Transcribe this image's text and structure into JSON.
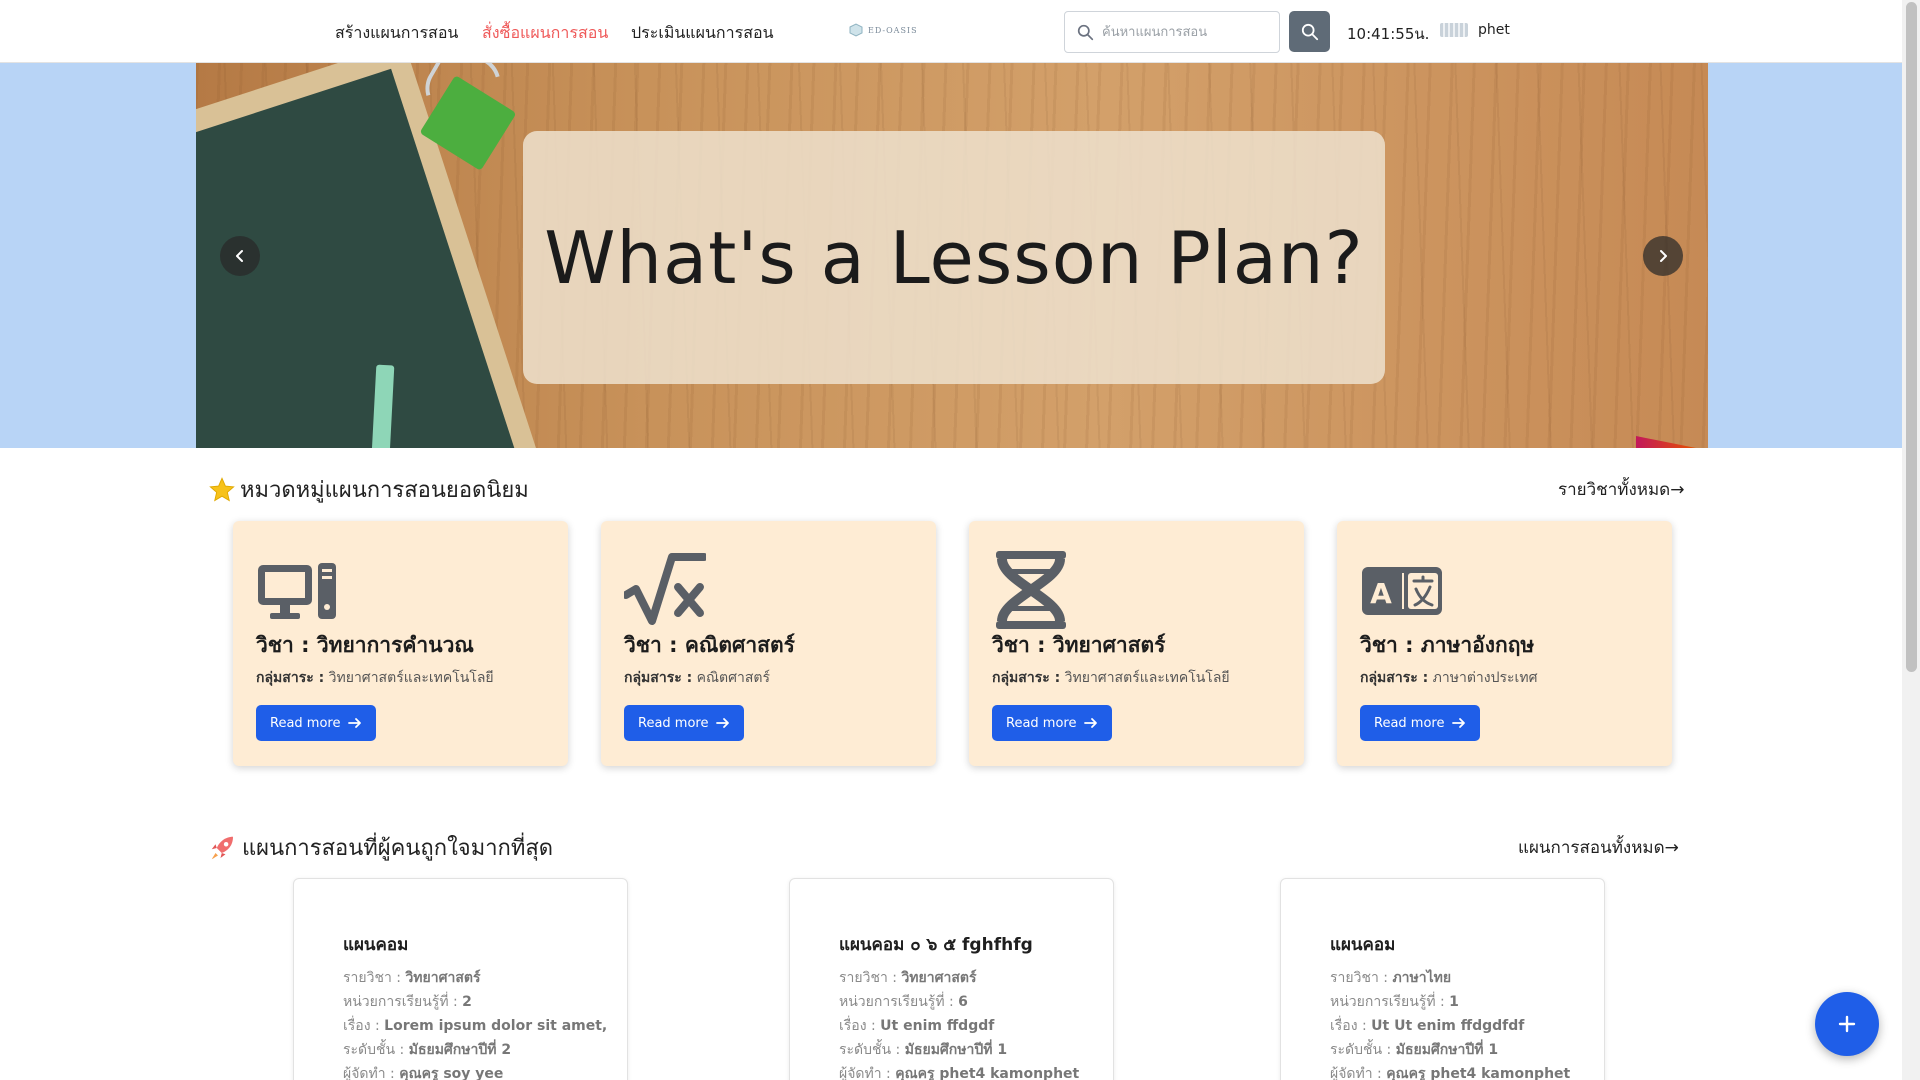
{
  "header": {
    "nav": [
      {
        "label": "สร้างแผนการสอน",
        "active": false
      },
      {
        "label": "สั่งซื้อแผนการสอน",
        "active": true
      },
      {
        "label": "ประเมินแผนการสอน",
        "active": false
      }
    ],
    "logo_text": "ED-OASIS",
    "search_placeholder": "ค้นหาแผนการสอน",
    "clock": "10:41:55น.",
    "username": "phet"
  },
  "banner": {
    "title": "What's a Lesson Plan?"
  },
  "popular_categories": {
    "title": "หมวดหมู่แผนการสอนยอดนิยม",
    "see_all": "รายวิชาทั้งหมด→",
    "group_label": "กลุ่มสาระ :",
    "read_more": "Read more",
    "cards": [
      {
        "subject": "วิชา : วิทยาการคำนวณ",
        "group": "วิทยาศาสตร์และเทคโนโลยี",
        "icon": "computer-icon"
      },
      {
        "subject": "วิชา : คณิตศาสตร์",
        "group": "คณิตศาสตร์",
        "icon": "square-root-icon"
      },
      {
        "subject": "วิชา : วิทยาศาสตร์",
        "group": "วิทยาศาสตร์และเทคโนโลยี",
        "icon": "dna-icon"
      },
      {
        "subject": "วิชา : ภาษาอังกฤษ",
        "group": "ภาษาต่างประเทศ",
        "icon": "language-icon"
      }
    ]
  },
  "popular_plans": {
    "title": "แผนการสอนที่ผู้คนถูกใจมากที่สุด",
    "see_all": "แผนการสอนทั้งหมด→",
    "labels": {
      "course": "รายวิชา :",
      "unit": "หน่วยการเรียนรู้ที่ :",
      "topic": "เรื่อง :",
      "level": "ระดับชั้น :",
      "author": "ผู้จัดทำ :"
    },
    "cards": [
      {
        "title": "แผนคอม",
        "course": "วิทยาศาสตร์",
        "unit": "2",
        "topic": "Lorem ipsum dolor sit amet,",
        "level": "มัธยมศึกษาปีที่ 2",
        "author": "คุณครู soy yee"
      },
      {
        "title": "แผนคอม ๐ ๖ ๕ fghfhfg",
        "course": "วิทยาศาสตร์",
        "unit": "6",
        "topic": "Ut enim ffdgdf",
        "level": "มัธยมศึกษาปีที่ 1",
        "author": "คุณครู phet4 kamonphet"
      },
      {
        "title": "แผนคอม",
        "course": "ภาษาไทย",
        "unit": "1",
        "topic": "Ut Ut enim ffdgdfdf",
        "level": "มัธยมศึกษาปีที่ 1",
        "author": "คุณครู phet4 kamonphet"
      }
    ]
  },
  "colors": {
    "primary": "#1f5ee8",
    "nav_active": "#ef5a5a",
    "card_bg": "#feecd4",
    "banner_side": "#b8d4f6"
  }
}
